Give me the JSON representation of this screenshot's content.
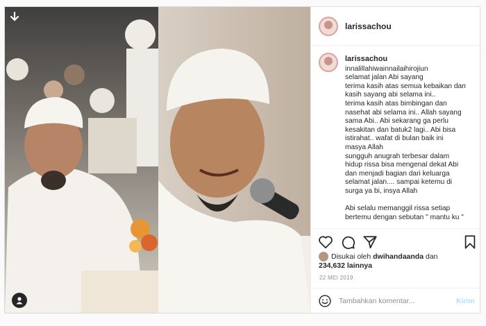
{
  "post": {
    "author": "larissachou",
    "caption": {
      "username": "larissachou",
      "lines": [
        "innalillahiwainnailaihirojiun",
        "selamat jalan Abi sayang",
        "terima kasih atas semua kebaikan dan",
        "kasih sayang abi selama ini..",
        "terima kasih atas bimbingan dan",
        "nasehat abi selama ini.. Allah sayang",
        "sama Abi.. Abi sekarang ga perlu",
        "kesakitan dan batuk2 lagi.. Abi bisa",
        "istirahat.. wafat di bulan baik ini",
        "masya Allah",
        "sungguh anugrah terbesar dalam",
        "hidup rissa bisa mengenal dekat Abi",
        "dan menjadi bagian dari keluarga",
        "selamat jalan.... sampai ketemu di",
        "surga ya bi, insya Allah",
        "",
        "Abi selalu memanggil rissa setiap",
        "bertemu dengan sebutan \" mantu ku \""
      ]
    },
    "likes": {
      "prefix": "Disukai oleh",
      "liked_by": "dwihandaanda",
      "connector": "dan",
      "count": "234,632 lainnya"
    },
    "date": "22 MEI 2019",
    "comment": {
      "placeholder": "Tambahkan komentar...",
      "post_label": "Kirim"
    }
  },
  "icons": {
    "carousel": "carousel-arrow-icon",
    "user_tag": "user-tag-icon",
    "like": "heart-icon",
    "comment": "comment-icon",
    "share": "share-icon",
    "save": "bookmark-icon",
    "emoji": "emoji-icon"
  },
  "colors": {
    "link_disabled": "#b2dffc",
    "text": "#262626",
    "muted": "#8e8e8e"
  }
}
